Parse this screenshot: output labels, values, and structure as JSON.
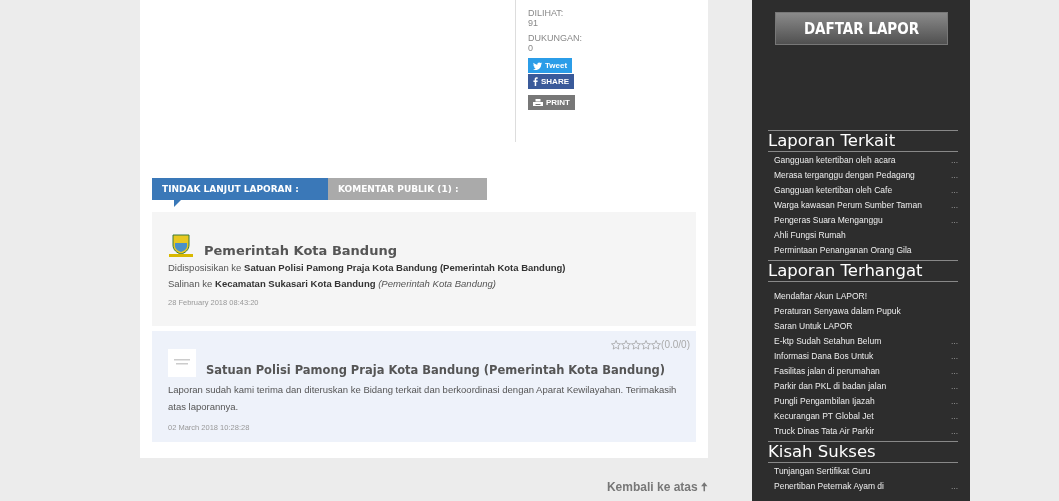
{
  "stats": [
    {
      "label": "DILIHAT:",
      "value": "91"
    },
    {
      "label": "DUKUNGAN:",
      "value": "0"
    }
  ],
  "share_buttons": [
    {
      "kind": "tweet",
      "label": "Tweet"
    },
    {
      "kind": "facebook",
      "label": "SHARE"
    },
    {
      "kind": "print",
      "label": "PRINT"
    }
  ],
  "tabs": [
    {
      "label": "TINDAK LANJUT LAPORAN :",
      "selected": true
    },
    {
      "label": "KOMENTAR PUBLIK (1) :",
      "selected": false
    }
  ],
  "responses": [
    {
      "kind": "disposition",
      "author": "Pemerintah Kota Bandung",
      "lines": [
        "Didisposisikan ke **Satuan Polisi Pamong Praja Kota Bandung (Pemerintah Kota Bandung)**",
        "Salinan ke **Kecamatan Sukasari Kota Bandung** *(Pemerintah Kota Bandung)*"
      ],
      "date": "28 February 2018 08:43:20"
    },
    {
      "kind": "reply",
      "author": "Satuan Polisi Pamong Praja Kota Bandung (Pemerintah Kota Bandung)",
      "stars": 0,
      "rating": "(0.0/0)",
      "lines": [
        "Laporan sudah kami terima dan diteruskan ke Bidang terkait dan berkoordinasi dengan Aparat Kewilayahan. Terimakasih atas laporannya."
      ],
      "date": "02 March 2018 10:28:28"
    }
  ],
  "back_to_top": {
    "label": "Kembali ke atas",
    "icon": "🠅"
  },
  "sidebar": {
    "button": "DAFTAR LAPOR",
    "sections": [
      {
        "title": "Laporan Terkait",
        "items": [
          {
            "title": "Gangguan ketertiban oleh acara",
            "more": "..."
          },
          {
            "title": "Merasa terganggu dengan Pedagang",
            "more": "..."
          },
          {
            "title": "Gangguan ketertiban oleh Cafe",
            "more": "..."
          },
          {
            "title": "Warga kawasan Perum Sumber Taman",
            "more": "..."
          },
          {
            "title": "Pengeras Suara Menganggu",
            "more": "..."
          },
          {
            "title": "Ahli Fungsi Rumah"
          },
          {
            "title": "Permintaan Penanganan Orang Gila"
          }
        ]
      },
      {
        "title": "Laporan Terhangat",
        "items": [
          {
            "title": "Mendaftar Akun LAPOR!"
          },
          {
            "title": "Peraturan Senyawa dalam Pupuk"
          },
          {
            "title": "Saran Untuk LAPOR"
          },
          {
            "title": "E-ktp Sudah Setahun Belum",
            "more": "..."
          },
          {
            "title": "Informasi Dana Bos Untuk",
            "more": "..."
          },
          {
            "title": "Fasilitas jalan di perumahan",
            "more": "..."
          },
          {
            "title": "Parkir dan PKL di badan jalan",
            "more": "..."
          },
          {
            "title": "Pungli Pengambilan Ijazah",
            "more": "..."
          },
          {
            "title": "Kecurangan PT Global Jet",
            "more": "..."
          },
          {
            "title": "Truck Dinas Tata Air Parkir",
            "more": "..."
          }
        ]
      },
      {
        "title": "Kisah Sukses",
        "items": [
          {
            "title": "Tunjangan Sertifikat Guru"
          },
          {
            "title": "Penertiban Peternak Ayam di",
            "more": "..."
          }
        ]
      }
    ]
  }
}
